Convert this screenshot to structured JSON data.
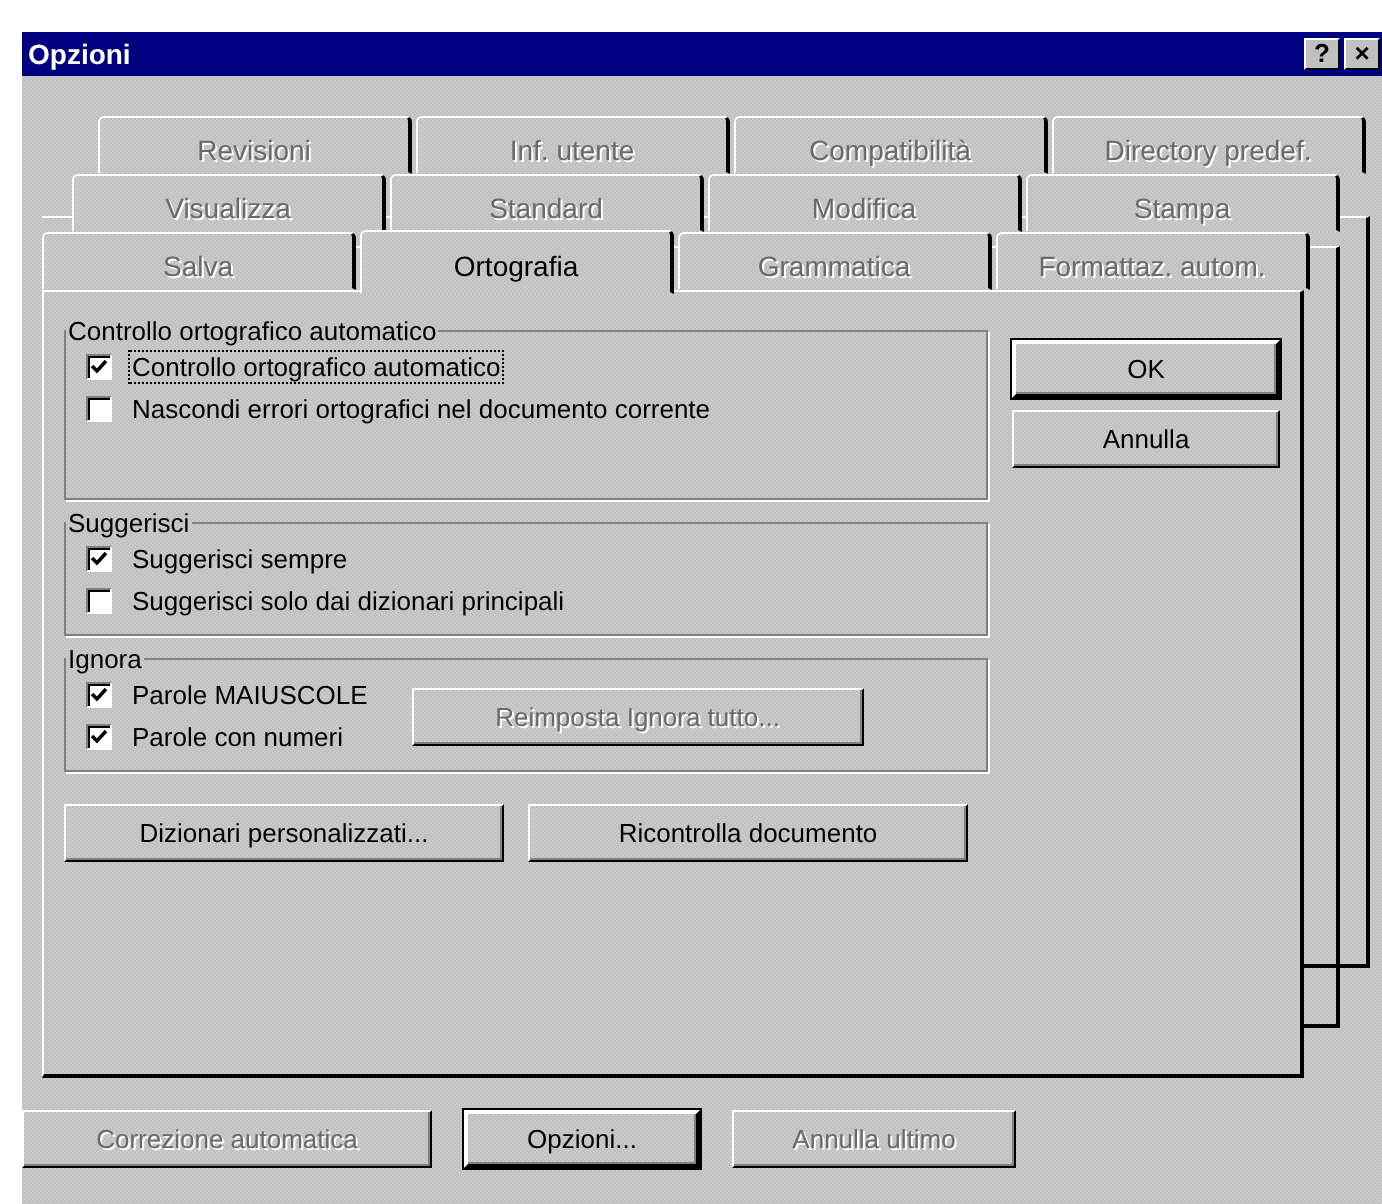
{
  "window": {
    "title": "Opzioni",
    "help_button": "?",
    "close_button": "×"
  },
  "tab_rows": [
    {
      "tabs": [
        {
          "label": "Revisioni",
          "selected": false,
          "disabled": true
        },
        {
          "label": "Inf. utente",
          "selected": false,
          "disabled": true
        },
        {
          "label": "Compatibilità",
          "selected": false,
          "disabled": true
        },
        {
          "label": "Directory predef.",
          "selected": false,
          "disabled": true
        }
      ]
    },
    {
      "tabs": [
        {
          "label": "Visualizza",
          "selected": false,
          "disabled": true
        },
        {
          "label": "Standard",
          "selected": false,
          "disabled": true
        },
        {
          "label": "Modifica",
          "selected": false,
          "disabled": true
        },
        {
          "label": "Stampa",
          "selected": false,
          "disabled": true
        }
      ]
    },
    {
      "tabs": [
        {
          "label": "Salva",
          "selected": false,
          "disabled": true
        },
        {
          "label": "Ortografia",
          "selected": true,
          "disabled": false
        },
        {
          "label": "Grammatica",
          "selected": false,
          "disabled": true
        },
        {
          "label": "Formattaz. autom.",
          "selected": false,
          "disabled": true
        }
      ]
    }
  ],
  "groups": [
    {
      "title": "Controllo ortografico automatico",
      "items": [
        {
          "label": "Controllo ortografico automatico",
          "checked": true,
          "focused": true
        },
        {
          "label": "Nascondi errori ortografici nel documento corrente",
          "checked": false,
          "focused": false
        }
      ]
    },
    {
      "title": "Suggerisci",
      "items": [
        {
          "label": "Suggerisci sempre",
          "checked": true,
          "focused": false
        },
        {
          "label": "Suggerisci solo dai dizionari principali",
          "checked": false,
          "focused": false
        }
      ]
    },
    {
      "title": "Ignora",
      "items": [
        {
          "label": "Parole MAIUSCOLE",
          "checked": true,
          "focused": false
        },
        {
          "label": "Parole con numeri",
          "checked": true,
          "focused": false
        }
      ],
      "button": {
        "label": "Reimposta Ignora tutto...",
        "disabled": true
      }
    }
  ],
  "side_buttons": [
    {
      "label": "OK",
      "default": true
    },
    {
      "label": "Annulla",
      "default": false
    }
  ],
  "panel_buttons": [
    {
      "label": "Dizionari personalizzati...",
      "disabled": false
    },
    {
      "label": "Ricontrolla documento",
      "disabled": false
    }
  ],
  "bottom_buttons": [
    {
      "label": "Correzione automatica",
      "disabled": true,
      "default": false
    },
    {
      "label": "Opzioni...",
      "disabled": false,
      "default": true
    },
    {
      "label": "Annulla ultimo",
      "disabled": true,
      "default": false
    }
  ]
}
